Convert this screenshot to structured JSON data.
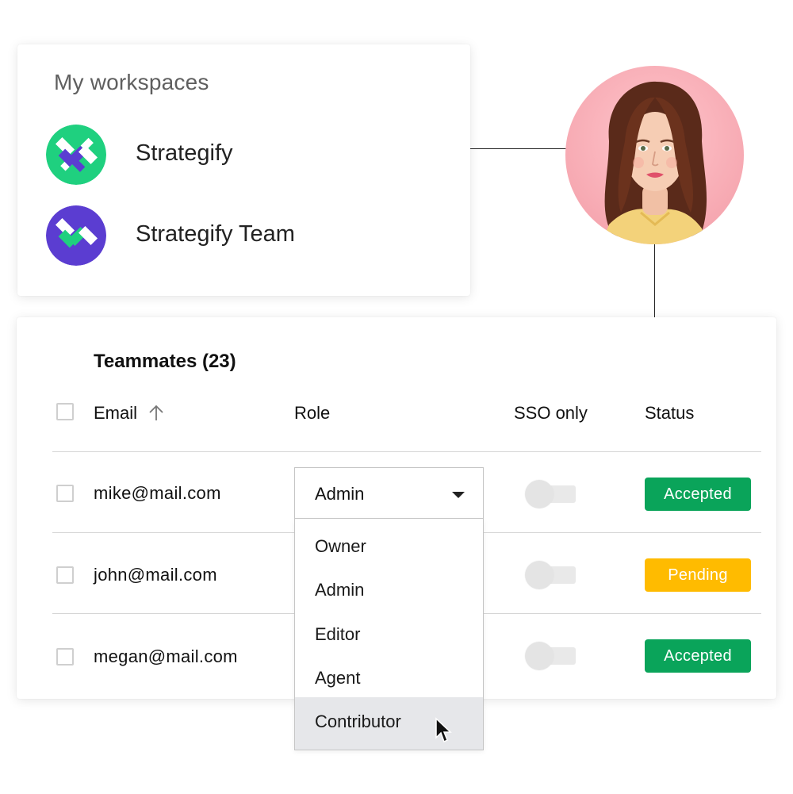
{
  "workspaces": {
    "title": "My workspaces",
    "items": [
      {
        "name": "Strategify",
        "logo_bg": "#1fd07f",
        "logo_accent": "#5b3dd1"
      },
      {
        "name": "Strategify Team",
        "logo_bg": "#5b3dd1",
        "logo_accent": "#1fd07f"
      }
    ]
  },
  "teammates": {
    "title": "Teammates (23)",
    "columns": {
      "email": "Email",
      "role": "Role",
      "sso": "SSO only",
      "status": "Status"
    },
    "rows": [
      {
        "email": "mike@mail.com",
        "role": "Admin",
        "sso_only": false,
        "status": "Accepted"
      },
      {
        "email": "john@mail.com",
        "role": "",
        "sso_only": false,
        "status": "Pending"
      },
      {
        "email": "megan@mail.com",
        "role": "",
        "sso_only": false,
        "status": "Accepted"
      }
    ],
    "role_dropdown": {
      "selected": "Admin",
      "options": [
        "Owner",
        "Admin",
        "Editor",
        "Agent",
        "Contributor"
      ],
      "hovered": "Contributor"
    }
  },
  "colors": {
    "accepted": "#0aa45a",
    "pending": "#ffbb00",
    "brand_green": "#1fd07f",
    "brand_purple": "#5b3dd1"
  },
  "icons": {
    "sort": "arrow-up-icon",
    "caret": "caret-down-icon",
    "pointer": "mouse-pointer-icon"
  }
}
